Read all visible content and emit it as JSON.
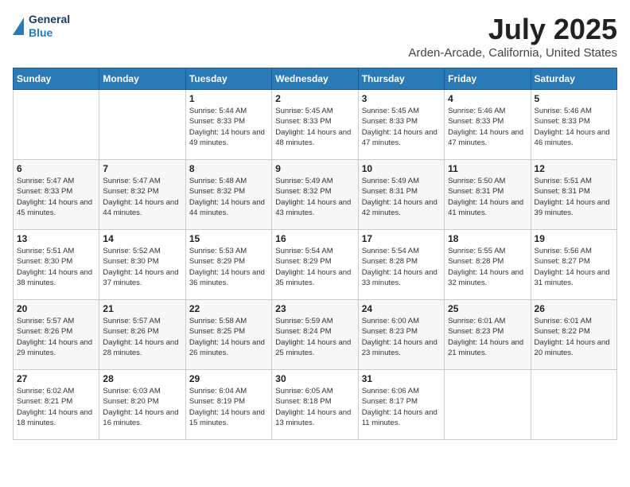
{
  "logo": {
    "line1": "General",
    "line2": "Blue"
  },
  "title": "July 2025",
  "subtitle": "Arden-Arcade, California, United States",
  "days_header": [
    "Sunday",
    "Monday",
    "Tuesday",
    "Wednesday",
    "Thursday",
    "Friday",
    "Saturday"
  ],
  "weeks": [
    [
      {
        "num": "",
        "info": ""
      },
      {
        "num": "",
        "info": ""
      },
      {
        "num": "1",
        "info": "Sunrise: 5:44 AM\nSunset: 8:33 PM\nDaylight: 14 hours and 49 minutes."
      },
      {
        "num": "2",
        "info": "Sunrise: 5:45 AM\nSunset: 8:33 PM\nDaylight: 14 hours and 48 minutes."
      },
      {
        "num": "3",
        "info": "Sunrise: 5:45 AM\nSunset: 8:33 PM\nDaylight: 14 hours and 47 minutes."
      },
      {
        "num": "4",
        "info": "Sunrise: 5:46 AM\nSunset: 8:33 PM\nDaylight: 14 hours and 47 minutes."
      },
      {
        "num": "5",
        "info": "Sunrise: 5:46 AM\nSunset: 8:33 PM\nDaylight: 14 hours and 46 minutes."
      }
    ],
    [
      {
        "num": "6",
        "info": "Sunrise: 5:47 AM\nSunset: 8:33 PM\nDaylight: 14 hours and 45 minutes."
      },
      {
        "num": "7",
        "info": "Sunrise: 5:47 AM\nSunset: 8:32 PM\nDaylight: 14 hours and 44 minutes."
      },
      {
        "num": "8",
        "info": "Sunrise: 5:48 AM\nSunset: 8:32 PM\nDaylight: 14 hours and 44 minutes."
      },
      {
        "num": "9",
        "info": "Sunrise: 5:49 AM\nSunset: 8:32 PM\nDaylight: 14 hours and 43 minutes."
      },
      {
        "num": "10",
        "info": "Sunrise: 5:49 AM\nSunset: 8:31 PM\nDaylight: 14 hours and 42 minutes."
      },
      {
        "num": "11",
        "info": "Sunrise: 5:50 AM\nSunset: 8:31 PM\nDaylight: 14 hours and 41 minutes."
      },
      {
        "num": "12",
        "info": "Sunrise: 5:51 AM\nSunset: 8:31 PM\nDaylight: 14 hours and 39 minutes."
      }
    ],
    [
      {
        "num": "13",
        "info": "Sunrise: 5:51 AM\nSunset: 8:30 PM\nDaylight: 14 hours and 38 minutes."
      },
      {
        "num": "14",
        "info": "Sunrise: 5:52 AM\nSunset: 8:30 PM\nDaylight: 14 hours and 37 minutes."
      },
      {
        "num": "15",
        "info": "Sunrise: 5:53 AM\nSunset: 8:29 PM\nDaylight: 14 hours and 36 minutes."
      },
      {
        "num": "16",
        "info": "Sunrise: 5:54 AM\nSunset: 8:29 PM\nDaylight: 14 hours and 35 minutes."
      },
      {
        "num": "17",
        "info": "Sunrise: 5:54 AM\nSunset: 8:28 PM\nDaylight: 14 hours and 33 minutes."
      },
      {
        "num": "18",
        "info": "Sunrise: 5:55 AM\nSunset: 8:28 PM\nDaylight: 14 hours and 32 minutes."
      },
      {
        "num": "19",
        "info": "Sunrise: 5:56 AM\nSunset: 8:27 PM\nDaylight: 14 hours and 31 minutes."
      }
    ],
    [
      {
        "num": "20",
        "info": "Sunrise: 5:57 AM\nSunset: 8:26 PM\nDaylight: 14 hours and 29 minutes."
      },
      {
        "num": "21",
        "info": "Sunrise: 5:57 AM\nSunset: 8:26 PM\nDaylight: 14 hours and 28 minutes."
      },
      {
        "num": "22",
        "info": "Sunrise: 5:58 AM\nSunset: 8:25 PM\nDaylight: 14 hours and 26 minutes."
      },
      {
        "num": "23",
        "info": "Sunrise: 5:59 AM\nSunset: 8:24 PM\nDaylight: 14 hours and 25 minutes."
      },
      {
        "num": "24",
        "info": "Sunrise: 6:00 AM\nSunset: 8:23 PM\nDaylight: 14 hours and 23 minutes."
      },
      {
        "num": "25",
        "info": "Sunrise: 6:01 AM\nSunset: 8:23 PM\nDaylight: 14 hours and 21 minutes."
      },
      {
        "num": "26",
        "info": "Sunrise: 6:01 AM\nSunset: 8:22 PM\nDaylight: 14 hours and 20 minutes."
      }
    ],
    [
      {
        "num": "27",
        "info": "Sunrise: 6:02 AM\nSunset: 8:21 PM\nDaylight: 14 hours and 18 minutes."
      },
      {
        "num": "28",
        "info": "Sunrise: 6:03 AM\nSunset: 8:20 PM\nDaylight: 14 hours and 16 minutes."
      },
      {
        "num": "29",
        "info": "Sunrise: 6:04 AM\nSunset: 8:19 PM\nDaylight: 14 hours and 15 minutes."
      },
      {
        "num": "30",
        "info": "Sunrise: 6:05 AM\nSunset: 8:18 PM\nDaylight: 14 hours and 13 minutes."
      },
      {
        "num": "31",
        "info": "Sunrise: 6:06 AM\nSunset: 8:17 PM\nDaylight: 14 hours and 11 minutes."
      },
      {
        "num": "",
        "info": ""
      },
      {
        "num": "",
        "info": ""
      }
    ]
  ]
}
